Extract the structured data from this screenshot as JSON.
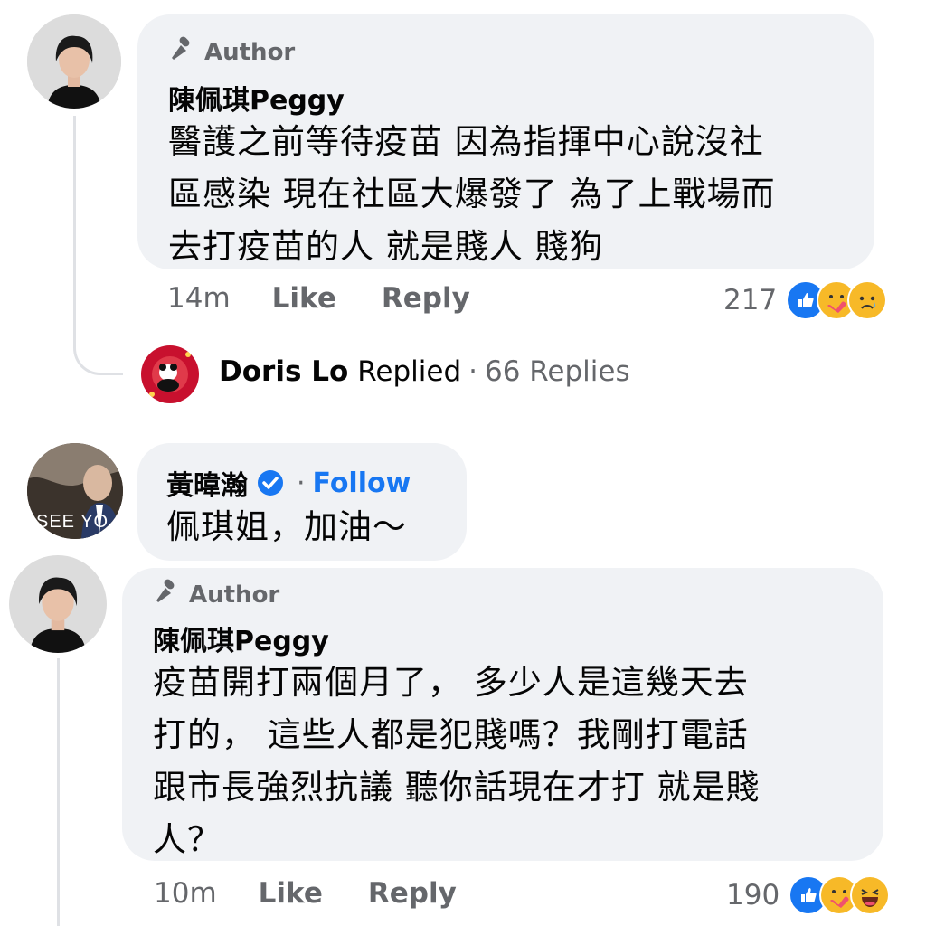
{
  "comments": [
    {
      "badge": "Author",
      "name": "陳佩琪Peggy",
      "lines": [
        "醫護之前等待疫苗 因為指揮中心說沒社",
        "區感染 現在社區大爆發了 為了上戰場而",
        "去打疫苗的人 就是賤人 賤狗"
      ],
      "time": "14m",
      "like": "Like",
      "reply": "Reply",
      "reaction_count": "217",
      "reactions": [
        "like-reaction-icon",
        "care-reaction-icon",
        "sad-reaction-icon"
      ]
    },
    {
      "name": "黃暐瀚",
      "follow_sep": "·",
      "follow": "Follow",
      "text": "佩琪姐，加油～",
      "avatar_caption": "SEE YO"
    },
    {
      "badge": "Author",
      "name": "陳佩琪Peggy",
      "lines": [
        "疫苗開打兩個月了， 多少人是這幾天去",
        "打的， 這些人都是犯賤嗎？我剛打電話",
        "跟市長強烈抗議 聽你話現在才打 就是賤",
        "人？"
      ],
      "time": "10m",
      "like": "Like",
      "reply": "Reply",
      "reaction_count": "190",
      "reactions": [
        "like-reaction-icon",
        "care-reaction-icon",
        "haha-reaction-icon"
      ]
    }
  ],
  "replies_summary": {
    "name": "Doris Lo",
    "action": "Replied",
    "sep": "·",
    "count": "66 Replies"
  },
  "colors": {
    "bubble": "#f0f2f5",
    "secondary_text": "#65676b",
    "link_blue": "#1877f2",
    "like_blue": "#1877f2",
    "reaction_yellow": "#f7b928"
  }
}
